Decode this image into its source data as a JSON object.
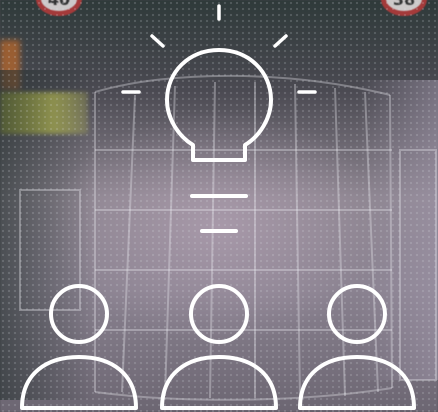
{
  "background": {
    "left_sign_text": "40",
    "right_sign_text": "38"
  },
  "icons": {
    "idea": "lightbulb-icon",
    "people": [
      "person-icon",
      "person-icon",
      "person-icon"
    ]
  },
  "colors": {
    "icon_stroke": "#ffffff"
  }
}
